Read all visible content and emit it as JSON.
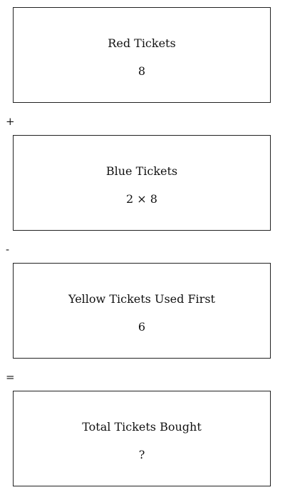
{
  "boxes": [
    {
      "title": "Red Tickets",
      "value": "8"
    },
    {
      "title": "Blue Tickets",
      "value": "2 × 8"
    },
    {
      "title": "Yellow Tickets Used First",
      "value": "6"
    },
    {
      "title": "Total Tickets Bought",
      "value": "?"
    }
  ],
  "operators": [
    "+",
    "-",
    "="
  ]
}
